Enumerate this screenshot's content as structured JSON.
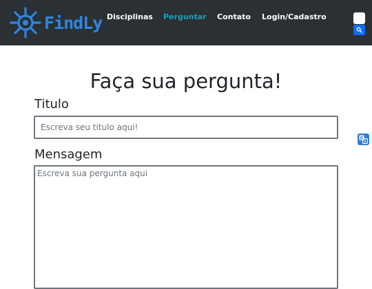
{
  "brand": {
    "logo_text": "FindLy",
    "logo_color": "#2f86e0"
  },
  "navbar": {
    "background": "#2b3035",
    "links": [
      {
        "label": "Disciplinas",
        "active": false
      },
      {
        "label": "Perguntar",
        "active": true
      },
      {
        "label": "Contato",
        "active": false
      },
      {
        "label": "Login/Cadastro",
        "active": false
      }
    ],
    "active_color": "#17a2b8",
    "search_icon": "search-icon"
  },
  "main": {
    "page_title": "Faça sua pergunta!",
    "title_label": "Titulo",
    "title_placeholder": "Escreva seu titulo aqui!",
    "message_label": "Mensagem",
    "message_placeholder": "Escreva sua pergunta aqui"
  },
  "floating": {
    "translate_icon": "translate-icon"
  }
}
